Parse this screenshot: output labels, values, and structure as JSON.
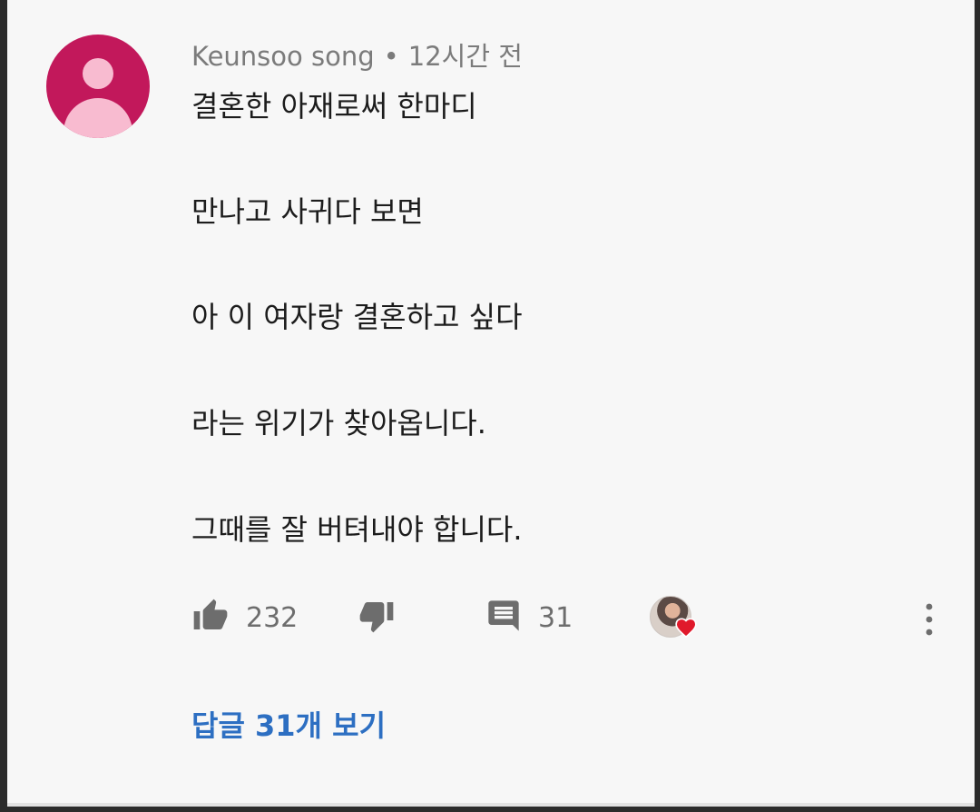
{
  "comment": {
    "author": "Keunsoo song",
    "separator": "•",
    "time": "12시간 전",
    "lines": [
      "결혼한 아재로써 한마디",
      "만나고 사귀다 보면",
      "아 이 여자랑 결혼하고 싶다",
      "라는 위기가 찾아옵니다.",
      "그때를 잘 버텨내야 합니다."
    ]
  },
  "actions": {
    "like_icon": "thumbs-up-icon",
    "like_count": "232",
    "dislike_icon": "thumbs-down-icon",
    "reply_icon": "comment-icon",
    "reply_count": "31",
    "creator_heart_icon": "heart-icon",
    "more_icon": "more-vertical-icon"
  },
  "replies_link": "답글 31개 보기",
  "colors": {
    "avatar_bg": "#c2185b",
    "avatar_fg": "#f8bbd0",
    "link": "#2d6fc2",
    "heart": "#e0192b",
    "icon_gray": "#6d6d6d"
  }
}
